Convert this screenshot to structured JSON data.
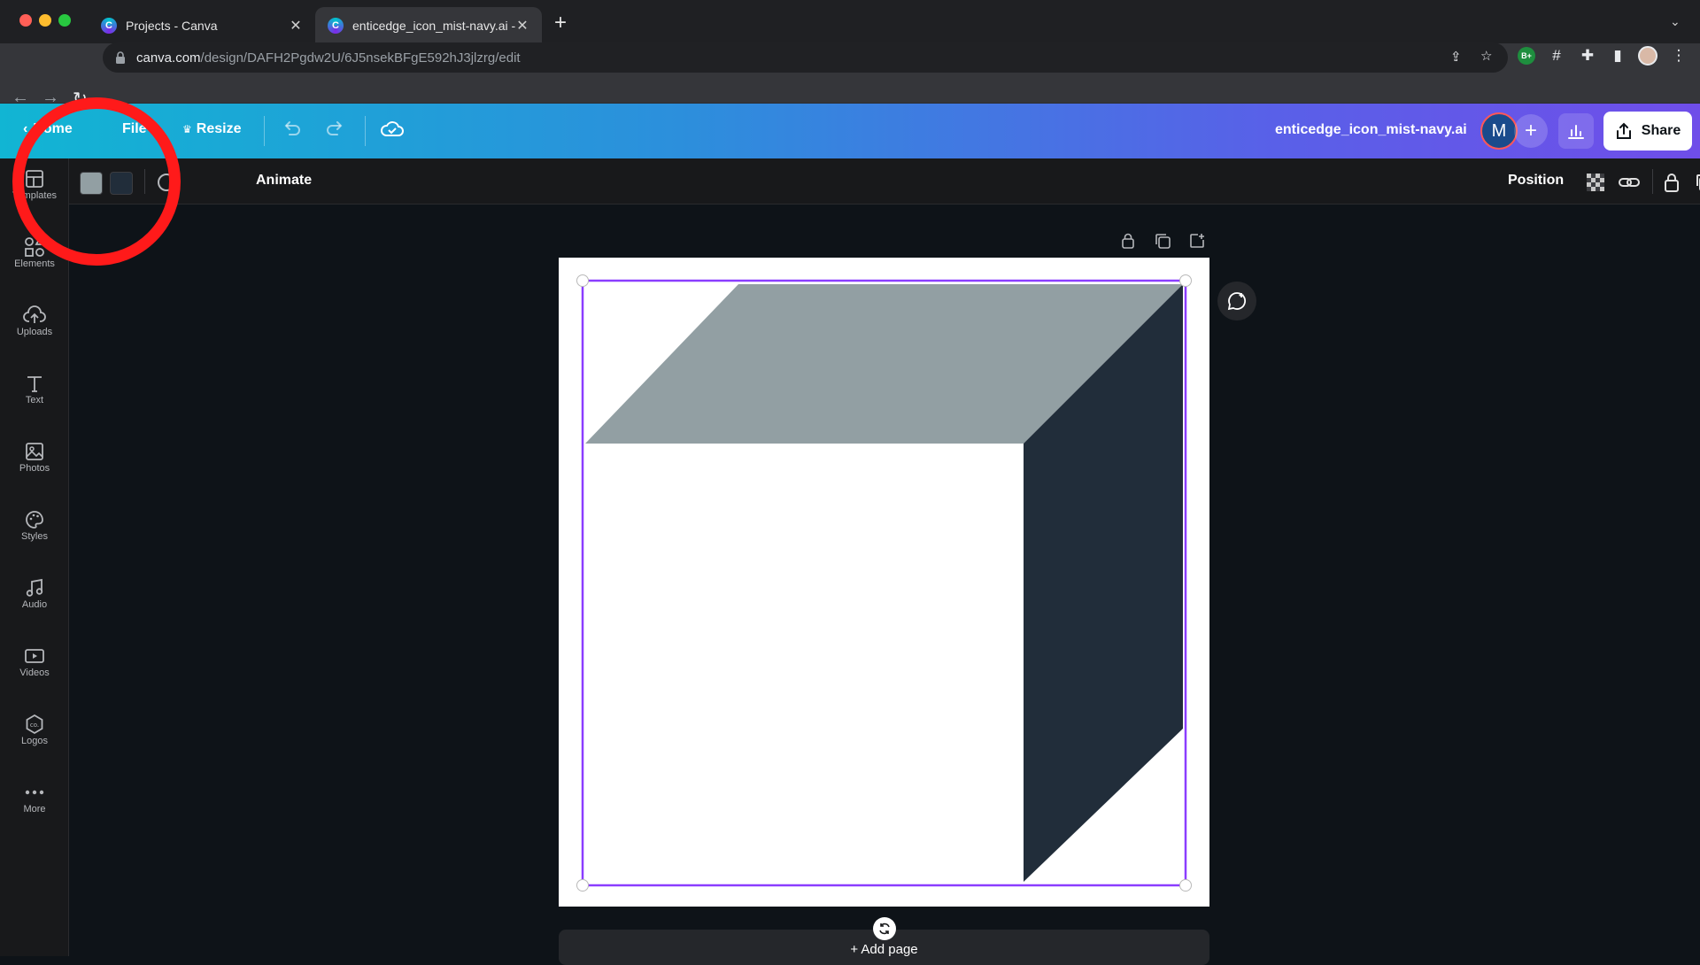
{
  "browser": {
    "tabs": [
      {
        "title": "Projects - Canva",
        "close": "✕"
      },
      {
        "title": "enticedge_icon_mist-navy.ai -",
        "close": "✕"
      }
    ],
    "new_tab": "+",
    "url_host": "canva.com",
    "url_path": "/design/DAFH2Pgdw2U/6J5nsekBFgE592hJ3jlzrg/edit",
    "extension_badge": "B+"
  },
  "header": {
    "home": "Home",
    "file": "File",
    "resize": "Resize",
    "doc_title": "enticedge_icon_mist-navy.ai",
    "avatar_initial": "M",
    "share": "Share"
  },
  "sidebar": {
    "items": [
      {
        "label": "Templates",
        "icon": "templates-icon"
      },
      {
        "label": "Elements",
        "icon": "elements-icon"
      },
      {
        "label": "Uploads",
        "icon": "uploads-icon"
      },
      {
        "label": "Text",
        "icon": "text-icon"
      },
      {
        "label": "Photos",
        "icon": "photos-icon"
      },
      {
        "label": "Styles",
        "icon": "styles-icon"
      },
      {
        "label": "Audio",
        "icon": "audio-icon"
      },
      {
        "label": "Videos",
        "icon": "videos-icon"
      },
      {
        "label": "Logos",
        "icon": "logos-icon"
      },
      {
        "label": "More",
        "icon": "more-icon"
      }
    ]
  },
  "toolbar": {
    "swatches": [
      "#929fa3",
      "#212d3a"
    ],
    "animate": "Animate",
    "position": "Position"
  },
  "canvas": {
    "add_page": "+ Add page",
    "shape_colors": {
      "top": "#929fa3",
      "side": "#212d3a"
    }
  },
  "colors": {
    "annotation": "#ff1a1a",
    "selection": "#8b3dff"
  }
}
